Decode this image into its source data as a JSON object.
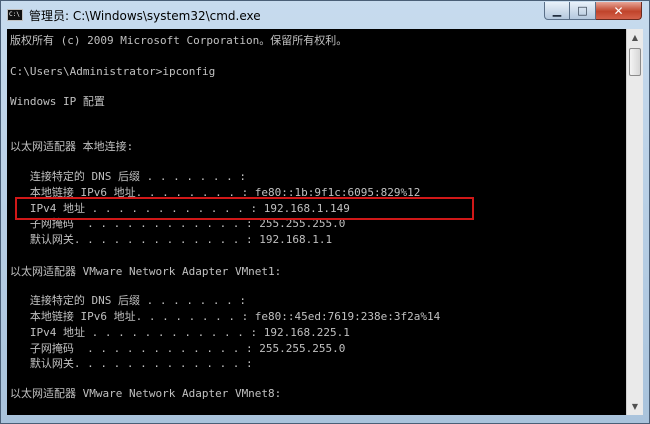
{
  "window": {
    "title": "管理员: C:\\Windows\\system32\\cmd.exe",
    "icon_label": "C:\\",
    "minimize_icon": "minimize-icon",
    "maximize_icon": "maximize-icon",
    "close_icon": "close-icon"
  },
  "buttons": {
    "minimize_glyph": "▁",
    "maximize_glyph": "□",
    "close_glyph": "✕"
  },
  "console": {
    "text_color": "#c0c0c0",
    "background": "#000000",
    "lines": [
      "版权所有 (c) 2009 Microsoft Corporation。保留所有权利。",
      "C:\\Users\\Administrator>ipconfig",
      "Windows IP 配置",
      "以太网适配器 本地连接:",
      "   连接特定的 DNS 后缀 . . . . . . . :",
      "   本地链接 IPv6 地址. . . . . . . . : fe80::1b:9f1c:6095:829%12",
      "   IPv4 地址 . . . . . . . . . . . . : 192.168.1.149",
      "   子网掩码  . . . . . . . . . . . . : 255.255.255.0",
      "   默认网关. . . . . . . . . . . . . : 192.168.1.1",
      "以太网适配器 VMware Network Adapter VMnet1:",
      "   连接特定的 DNS 后缀 . . . . . . . :",
      "   本地链接 IPv6 地址. . . . . . . . : fe80::45ed:7619:238e:3f2a%14",
      "   IPv4 地址 . . . . . . . . . . . . : 192.168.225.1",
      "   子网掩码  . . . . . . . . . . . . : 255.255.255.0",
      "   默认网关. . . . . . . . . . . . . :",
      "以太网适配器 VMware Network Adapter VMnet8:"
    ]
  },
  "annotation": {
    "highlight_color": "#d01818"
  },
  "scrollbar": {
    "up_glyph": "▲",
    "down_glyph": "▼"
  }
}
